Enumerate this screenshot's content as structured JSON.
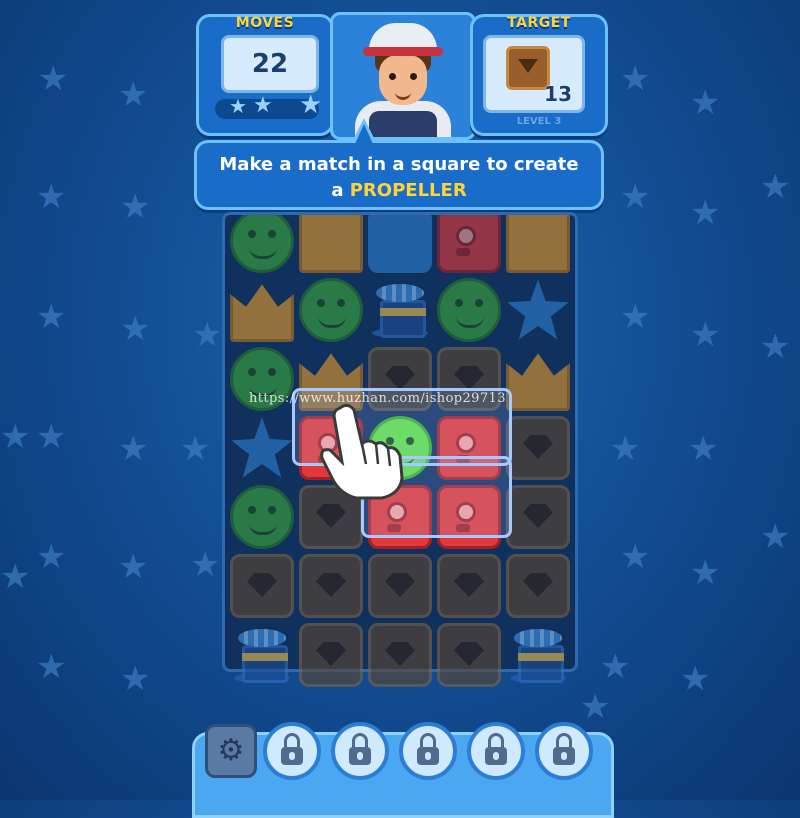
{
  "header": {
    "moves_label": "MOVES",
    "moves_value": "22",
    "stars_earned": 0,
    "stars_total": 3,
    "target_label": "TARGET",
    "target_icon": "crate-icon",
    "target_count": "13",
    "level_label": "LEVEL 3"
  },
  "tutorial": {
    "line1": "Make a match in a square to create",
    "line2_prefix": "a ",
    "line2_highlight": "PROPELLER"
  },
  "board": {
    "columns": 5,
    "rows": 7,
    "highlight_color": "#a7c9ff",
    "tiles": [
      [
        "frog",
        "crown",
        "star",
        "redbox",
        "crown"
      ],
      [
        "crown",
        "frog",
        "propeller",
        "frog",
        "star"
      ],
      [
        "frog",
        "crown",
        "crate",
        "crate",
        "crown"
      ],
      [
        "star",
        "redbox",
        "frog",
        "redbox",
        "crate"
      ],
      [
        "frog",
        "crate",
        "redbox",
        "redbox",
        "crate"
      ],
      [
        "crate",
        "crate",
        "crate",
        "crate",
        "crate"
      ],
      [
        "propeller",
        "crate",
        "crate",
        "crate",
        "propeller"
      ]
    ]
  },
  "watermark": "https://www.huzhan.com/ishop29713",
  "bottom_bar": {
    "settings_icon": "gear-icon",
    "locked_boosters": 5,
    "lock_icon": "lock-icon"
  },
  "colors": {
    "background": "#134f95",
    "panel": "#1a6cc9",
    "panel_border": "#6fc0ff",
    "title_yellow": "#ffd43a"
  }
}
